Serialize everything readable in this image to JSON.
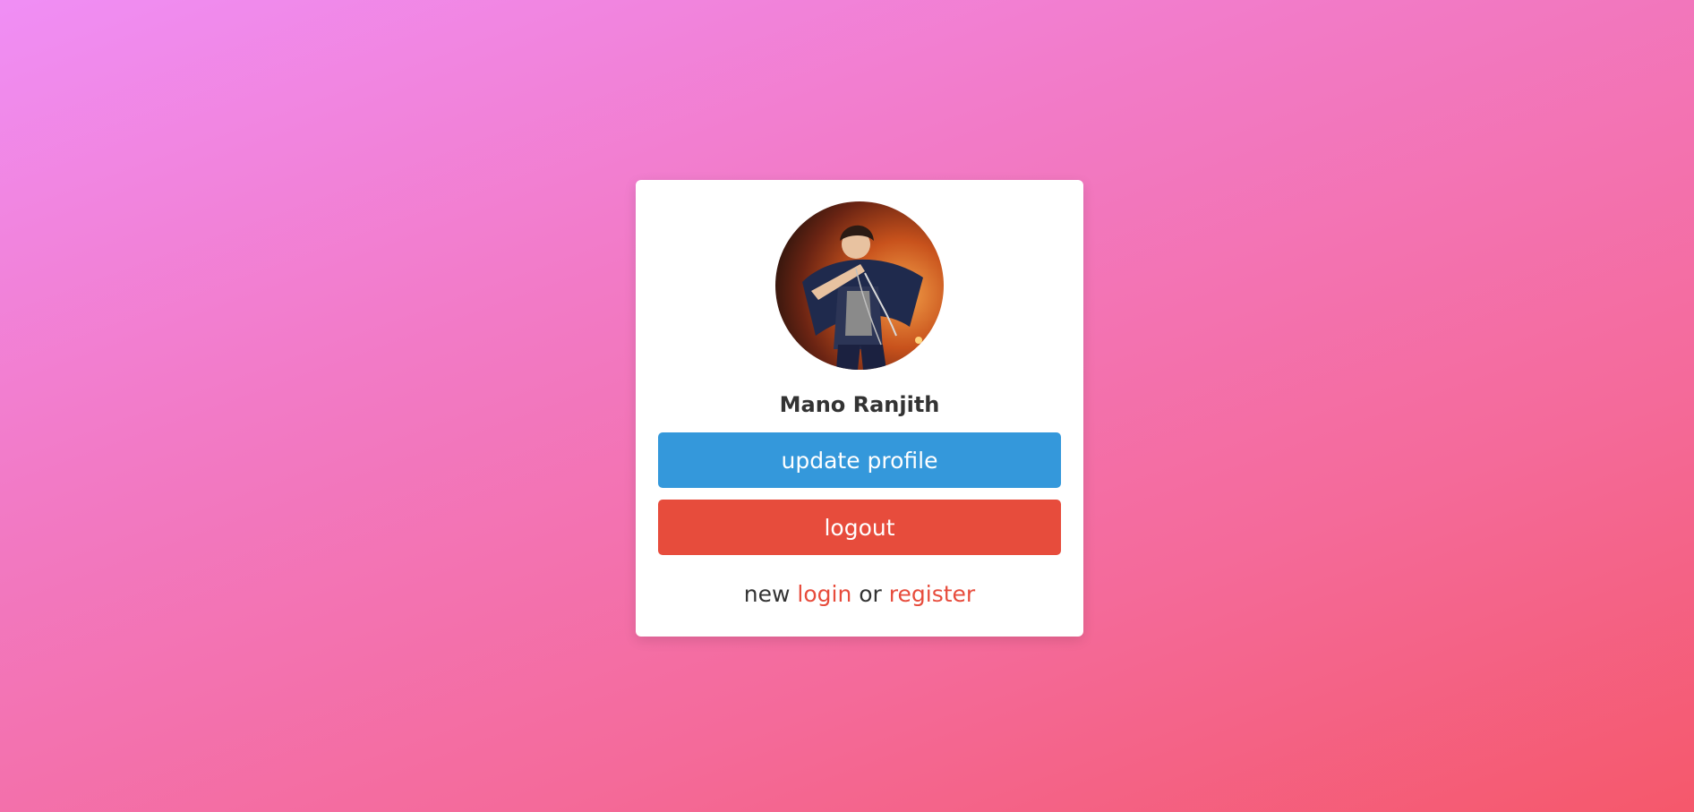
{
  "profile": {
    "name": "Mano Ranjith"
  },
  "actions": {
    "update_label": "update profile",
    "logout_label": "logout"
  },
  "footer": {
    "prefix": "new",
    "login_label": "login",
    "separator": "or",
    "register_label": "register"
  },
  "colors": {
    "primary": "#3498db",
    "danger": "#e74c3c",
    "text": "#333333",
    "card_bg": "#ffffff"
  }
}
